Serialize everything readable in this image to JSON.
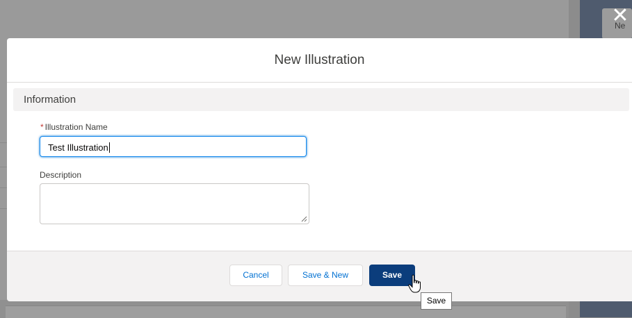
{
  "background": {
    "right_card_text": "Ne"
  },
  "modal": {
    "title": "New Illustration",
    "section_title": "Information",
    "name_field": {
      "required_mark": "*",
      "label": "Illustration Name",
      "value": "Test Illustration"
    },
    "description_field": {
      "label": "Description",
      "value": ""
    },
    "footer": {
      "cancel_label": "Cancel",
      "save_new_label": "Save & New",
      "save_label": "Save"
    }
  },
  "tooltip": {
    "text": "Save"
  },
  "icons": {
    "close": "close-icon",
    "resize": "resize-grip-icon",
    "cursor": "hand-pointer-icon"
  },
  "colors": {
    "brand_button": "#0b3d7c",
    "link_text": "#0070d2",
    "required": "#c23934",
    "focus_border": "#1589ee"
  }
}
